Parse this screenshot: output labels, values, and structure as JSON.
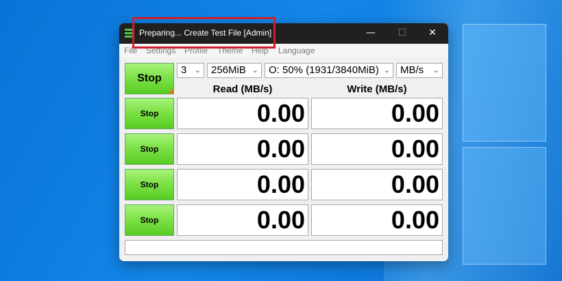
{
  "window": {
    "title": "Preparing... Create Test File [Admin]"
  },
  "menu": [
    "File",
    "Settings",
    "Profile",
    "Theme",
    "Help",
    "Language"
  ],
  "controls": {
    "count": "3",
    "size": "256MiB",
    "drive": "O: 50% (1931/3840MiB)",
    "unit": "MB/s"
  },
  "main_button": "Stop",
  "headers": {
    "read": "Read (MB/s)",
    "write": "Write (MB/s)"
  },
  "rows": [
    {
      "button": "Stop",
      "read": "0.00",
      "write": "0.00"
    },
    {
      "button": "Stop",
      "read": "0.00",
      "write": "0.00"
    },
    {
      "button": "Stop",
      "read": "0.00",
      "write": "0.00"
    },
    {
      "button": "Stop",
      "read": "0.00",
      "write": "0.00"
    }
  ],
  "status": ""
}
